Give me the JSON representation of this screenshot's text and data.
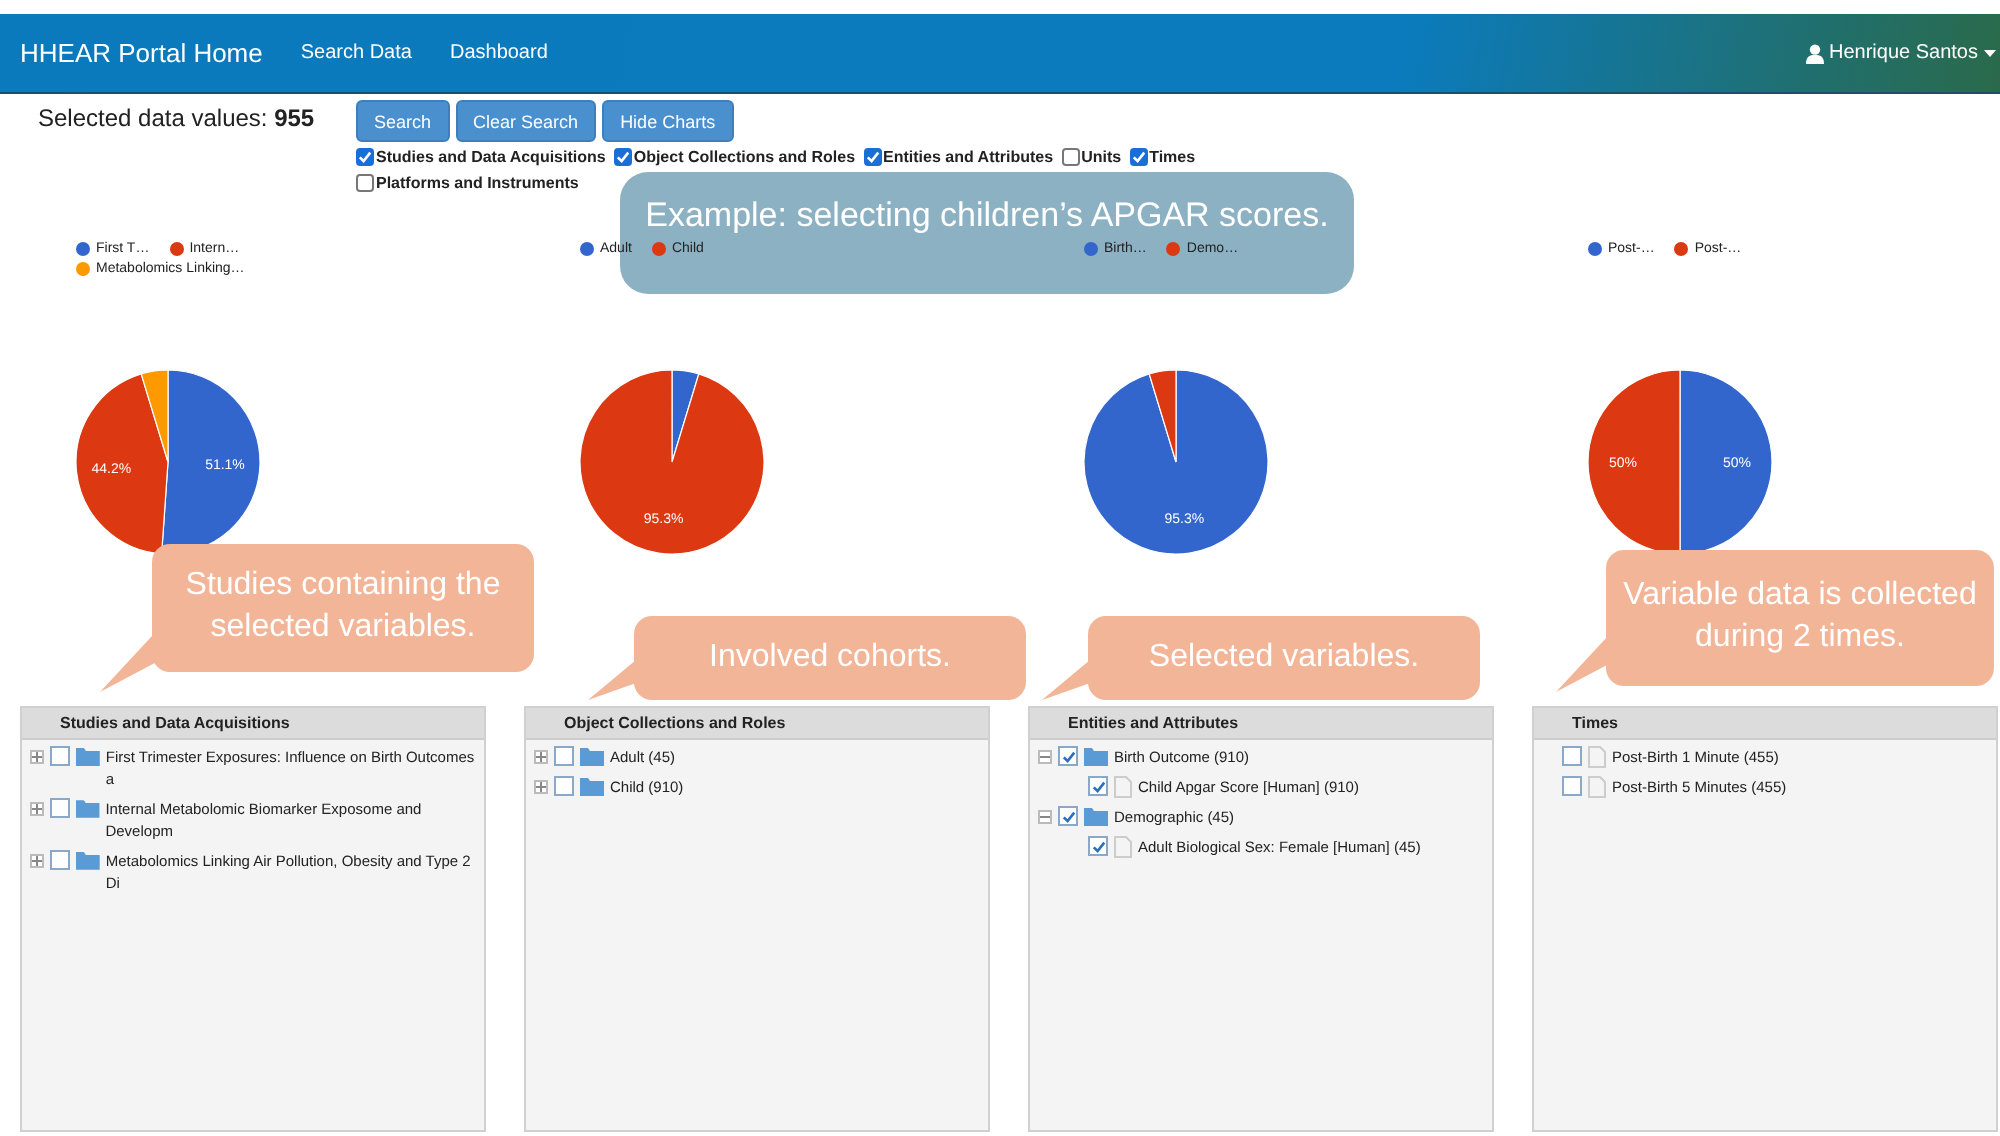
{
  "navbar": {
    "brand": "HHEAR Portal Home",
    "links": [
      "Search Data",
      "Dashboard"
    ],
    "user": "Henrique Santos"
  },
  "selected": {
    "label": "Selected data values:",
    "value": "955"
  },
  "buttons": [
    "Search",
    "Clear Search",
    "Hide Charts"
  ],
  "filters": [
    {
      "label": "Studies and Data Acquisitions",
      "checked": true
    },
    {
      "label": "Object Collections and Roles",
      "checked": true
    },
    {
      "label": "Entities and Attributes",
      "checked": true
    },
    {
      "label": "Units",
      "checked": false
    },
    {
      "label": "Times",
      "checked": true
    },
    {
      "label": "Platforms and Instruments",
      "checked": false
    }
  ],
  "facets": [
    {
      "chart_data": {
        "type": "pie",
        "categories": [
          "First T…",
          "Intern…",
          "Metabolomics Linking…"
        ],
        "values": [
          51.1,
          44.2,
          4.7
        ],
        "colors": [
          "#3366cc",
          "#dc3912",
          "#ff9900"
        ],
        "value_labels": [
          "51.1%",
          "44.2%",
          null
        ]
      },
      "panel": {
        "title": "Studies and Data Acquisitions",
        "tree": [
          {
            "label": "First Trimester Exposures: Influence on Birth Outcomes a",
            "kind": "folder",
            "checked": false,
            "expanded": false
          },
          {
            "label": "Internal Metabolomic Biomarker Exposome and Developm",
            "kind": "folder",
            "checked": false,
            "expanded": false
          },
          {
            "label": "Metabolomics Linking Air Pollution, Obesity and Type 2 Di",
            "kind": "folder",
            "checked": false,
            "expanded": false
          }
        ]
      }
    },
    {
      "chart_data": {
        "type": "pie",
        "categories": [
          "Adult",
          "Child"
        ],
        "values": [
          4.7,
          95.3
        ],
        "colors": [
          "#3366cc",
          "#dc3912"
        ],
        "value_labels": [
          null,
          "95.3%"
        ]
      },
      "panel": {
        "title": "Object Collections and Roles",
        "tree": [
          {
            "label": "Adult (45)",
            "kind": "folder",
            "checked": false,
            "expanded": false
          },
          {
            "label": "Child (910)",
            "kind": "folder",
            "checked": false,
            "expanded": false
          }
        ]
      }
    },
    {
      "chart_data": {
        "type": "pie",
        "categories": [
          "Birth…",
          "Demo…"
        ],
        "values": [
          95.3,
          4.7
        ],
        "colors": [
          "#3366cc",
          "#dc3912"
        ],
        "value_labels": [
          "95.3%",
          null
        ]
      },
      "panel": {
        "title": "Entities and Attributes",
        "tree": [
          {
            "label": "Birth Outcome (910)",
            "kind": "folder",
            "checked": true,
            "expanded": true,
            "children": [
              {
                "label": "Child Apgar Score [Human] (910)",
                "kind": "file",
                "checked": true
              }
            ]
          },
          {
            "label": "Demographic (45)",
            "kind": "folder",
            "checked": true,
            "expanded": true,
            "children": [
              {
                "label": "Adult Biological Sex: Female [Human] (45)",
                "kind": "file",
                "checked": true
              }
            ]
          }
        ]
      }
    },
    {
      "chart_data": {
        "type": "pie",
        "categories": [
          "Post-…",
          "Post-…"
        ],
        "values": [
          50,
          50
        ],
        "colors": [
          "#3366cc",
          "#dc3912"
        ],
        "value_labels": [
          "50%",
          "50%"
        ]
      },
      "panel": {
        "title": "Times",
        "tree": [
          {
            "label": "Post-Birth 1 Minute (455)",
            "kind": "file",
            "checked": false
          },
          {
            "label": "Post-Birth 5 Minutes (455)",
            "kind": "file",
            "checked": false
          }
        ]
      }
    }
  ],
  "example_note": "Example: selecting children’s APGAR scores.",
  "callouts": [
    "Studies containing the selected variables.",
    "Involved cohorts.",
    "Selected variables.",
    "Variable data is collected during 2 times."
  ]
}
